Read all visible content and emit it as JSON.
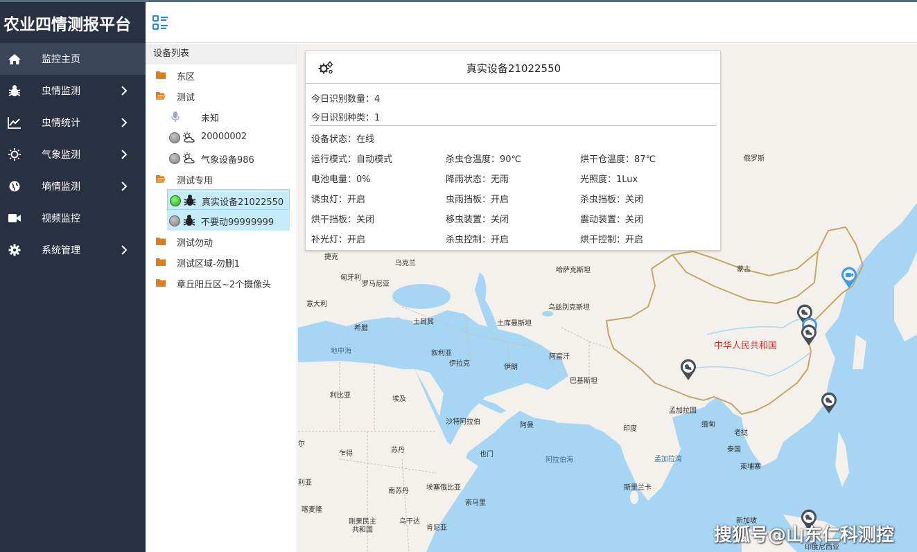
{
  "app": {
    "title": "农业四情测报平台"
  },
  "sidebar": {
    "items": [
      {
        "label": "监控主页",
        "icon": "home-icon",
        "active": true,
        "arrow": false
      },
      {
        "label": "虫情监测",
        "icon": "bug-icon",
        "arrow": true
      },
      {
        "label": "虫情统计",
        "icon": "line-chart-icon",
        "arrow": true
      },
      {
        "label": "气象监测",
        "icon": "sun-icon",
        "arrow": true
      },
      {
        "label": "墒情监测",
        "icon": "globe-icon",
        "arrow": true
      },
      {
        "label": "视频监控",
        "icon": "video-camera-icon",
        "arrow": false
      },
      {
        "label": "系统管理",
        "icon": "gear-icon",
        "arrow": true
      }
    ]
  },
  "tree": {
    "title": "设备列表",
    "nodes": [
      {
        "label": "东区",
        "type": "folder-closed"
      },
      {
        "label": "测试",
        "type": "folder-open"
      },
      {
        "label": "未知",
        "type": "device",
        "icon": "microphone-icon",
        "status": "none"
      },
      {
        "label": "20000002",
        "type": "device",
        "icon": "weather-icon",
        "status": "offline"
      },
      {
        "label": "气象设备986",
        "type": "device",
        "icon": "weather-icon",
        "status": "offline"
      },
      {
        "label": "测试专用",
        "type": "folder-open"
      },
      {
        "label": "真实设备21022550",
        "type": "device",
        "icon": "bug-icon",
        "status": "online",
        "selected": true
      },
      {
        "label": "不要动99999999",
        "type": "device",
        "icon": "bug-icon",
        "status": "offline",
        "selected": true
      },
      {
        "label": "测试勿动",
        "type": "folder-closed"
      },
      {
        "label": "测试区域-勿删1",
        "type": "folder-closed"
      },
      {
        "label": "章丘阳丘区~2个摄像头",
        "type": "folder-closed"
      }
    ]
  },
  "popup": {
    "title": "真实设备21022550",
    "today_count": "今日识别数量：4",
    "today_species": "今日识别种类：1",
    "status": "设备状态：在线",
    "fields": [
      [
        "运行模式：自动模式",
        "杀虫仓温度：90℃",
        "烘干仓温度：87℃"
      ],
      [
        "电池电量：0%",
        "降雨状态：无雨",
        "光照度：1Lux"
      ],
      [
        "诱虫灯：开启",
        "虫雨挡板：开启",
        "杀虫挡板：关闭"
      ],
      [
        "烘干挡板：关闭",
        "移虫装置：关闭",
        "震动装置：关闭"
      ],
      [
        "补光灯：开启",
        "杀虫控制：开启",
        "烘干控制：开启"
      ]
    ]
  },
  "map": {
    "labels": {
      "russia": "俄罗斯",
      "mongolia": "蒙古",
      "kazakhstan": "哈萨克斯坦",
      "uzbekistan": "乌兹别克斯坦",
      "turkmenistan": "土库曼斯坦",
      "afghanistan": "阿富汗",
      "pakistan": "巴基斯坦",
      "iran": "伊朗",
      "iraq": "伊拉克",
      "syria": "叙利亚",
      "turkey": "土耳其",
      "greece": "希腊",
      "italy": "意大利",
      "hungary": "匈牙利",
      "romania": "罗马尼亚",
      "ukraine": "乌克兰",
      "czech": "捷克",
      "mediterranean": "地中海",
      "libya": "利比亚",
      "egypt": "埃及",
      "saudi": "沙特阿拉伯",
      "oman": "阿曼",
      "yemen": "也门",
      "sudan": "苏丹",
      "chad": "乍得",
      "south_sudan": "南苏丹",
      "ethiopia": "埃塞俄比亚",
      "somalia": "索马里",
      "cameroon": "喀麦隆",
      "drc": "刚果民主共和国",
      "uganda": "乌干达",
      "kenya": "肯尼亚",
      "niger": "尔",
      "nigeria": "利亚",
      "india": "印度",
      "bangladesh": "孟加拉国",
      "myanmar": "缅甸",
      "laos": "老挝",
      "thailand": "泰国",
      "cambodia": "柬埔寨",
      "srilanka": "斯里兰卡",
      "singapore": "新加坡",
      "indonesia": "印度尼西亚",
      "arabian_sea": "阿拉伯海",
      "bay_of_bengal": "孟加拉湾",
      "china": "中华人民共和国"
    }
  },
  "watermark": "搜狐号@山东仁科测控",
  "colors": {
    "sidebar": "#283142",
    "accent": "#1e88e5",
    "online": "#28a51a",
    "selected": "#c6ebf9"
  }
}
